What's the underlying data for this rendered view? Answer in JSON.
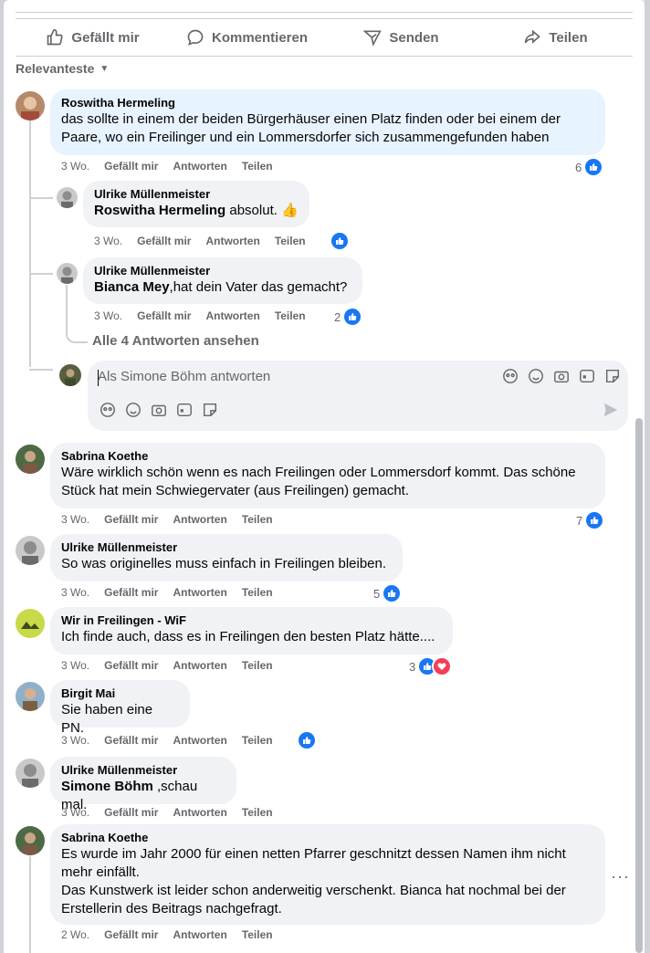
{
  "action_bar": {
    "like": "Gefällt mir",
    "comment": "Kommentieren",
    "send": "Senden",
    "share": "Teilen"
  },
  "sort_label": "Relevanteste",
  "meta_labels": {
    "like": "Gefällt mir",
    "reply": "Antworten",
    "share": "Teilen"
  },
  "comments": [
    {
      "author": "Roswitha Hermeling",
      "text": "das sollte in einem der beiden Bürgerhäuser einen Platz finden oder bei einem der Paare, wo ein Freilinger und ein Lommersdorfer sich zusammengefunden haben",
      "time": "3 Wo.",
      "reactions": "6"
    },
    {
      "author": "Ulrike Müllenmeister",
      "mention": "Roswitha Hermeling",
      "text": " absolut. 👍",
      "time": "3 Wo.",
      "reactions": ""
    },
    {
      "author": "Ulrike Müllenmeister",
      "mention": "Bianca Mey",
      "text": ",hat dein Vater das gemacht?",
      "time": "3 Wo.",
      "reactions": "2"
    },
    {
      "author": "Sabrina Koethe",
      "text": "Wäre wirklich schön wenn es nach Freilingen oder Lommersdorf kommt. Das schöne Stück hat mein Schwiegervater (aus Freilingen) gemacht.",
      "time": "3 Wo.",
      "reactions": "7"
    },
    {
      "author": "Ulrike Müllenmeister",
      "text": "So was originelles muss einfach in Freilingen bleiben.",
      "time": "3 Wo.",
      "reactions": "5"
    },
    {
      "author": "Wir in Freilingen - WiF",
      "text": "Ich finde auch, dass es in Freilingen den besten Platz hätte....",
      "time": "3 Wo.",
      "reactions": "3"
    },
    {
      "author": "Birgit Mai",
      "text": "Sie haben eine PN.",
      "time": "3 Wo.",
      "reactions": ""
    },
    {
      "author": "Ulrike Müllenmeister",
      "mention": "Simone Böhm",
      "text": " ,schau mal.",
      "time": "3 Wo.",
      "reactions": ""
    },
    {
      "author": "Sabrina Koethe",
      "text": "Es wurde im Jahr 2000 für einen netten Pfarrer geschnitzt dessen Namen ihm nicht mehr einfällt.\nDas Kunstwerk ist leider schon anderweitig verschenkt. Bianca hat nochmal bei der Erstellerin des Beitrags nachgefragt.",
      "time": "2 Wo.",
      "reactions": ""
    }
  ],
  "view_replies": "Alle 4 Antworten ansehen",
  "reply_input": {
    "placeholder": "Als Simone Böhm antworten"
  },
  "colors": {
    "accent": "#1877f2",
    "highlight_bubble": "#e7f3ff",
    "bubble": "#f0f2f5",
    "secondary_text": "#65676b",
    "love": "#f33e58"
  }
}
